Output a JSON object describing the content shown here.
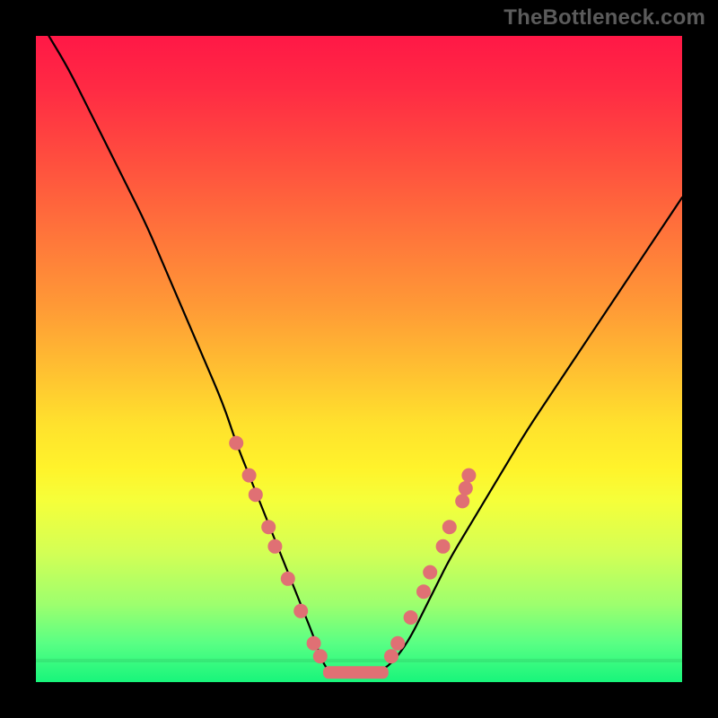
{
  "watermark": "TheBottleneck.com",
  "colors": {
    "curve_stroke": "#000000",
    "marker_fill": "#e07074",
    "plateau_fill": "#e07074",
    "frame_bg": "#000000"
  },
  "chart_data": {
    "type": "line",
    "title": "",
    "xlabel": "",
    "ylabel": "",
    "xlim": [
      0,
      100
    ],
    "ylim": [
      0,
      100
    ],
    "x": [
      2,
      5,
      8,
      11,
      14,
      17,
      20,
      23,
      26,
      29,
      31,
      33,
      35,
      37,
      39,
      41,
      43,
      44,
      45,
      46,
      48,
      50,
      52,
      54,
      56,
      58,
      60,
      62,
      64,
      67,
      70,
      73,
      76,
      80,
      84,
      88,
      92,
      96,
      100
    ],
    "values": [
      100,
      95,
      89,
      83,
      77,
      71,
      64,
      57,
      50,
      43,
      37,
      32,
      27,
      22,
      17,
      12,
      7,
      4,
      2,
      1.5,
      1.5,
      1.5,
      1.5,
      2,
      4,
      7,
      11,
      15,
      19,
      24,
      29,
      34,
      39,
      45,
      51,
      57,
      63,
      69,
      75
    ],
    "plateau": {
      "x_start": 45,
      "x_end": 54,
      "y": 1.5
    },
    "markers": [
      {
        "x": 31,
        "y": 37
      },
      {
        "x": 33,
        "y": 32
      },
      {
        "x": 34,
        "y": 29
      },
      {
        "x": 36,
        "y": 24
      },
      {
        "x": 37,
        "y": 21
      },
      {
        "x": 39,
        "y": 16
      },
      {
        "x": 41,
        "y": 11
      },
      {
        "x": 43,
        "y": 6
      },
      {
        "x": 44,
        "y": 4
      },
      {
        "x": 55,
        "y": 4
      },
      {
        "x": 56,
        "y": 6
      },
      {
        "x": 58,
        "y": 10
      },
      {
        "x": 60,
        "y": 14
      },
      {
        "x": 61,
        "y": 17
      },
      {
        "x": 63,
        "y": 21
      },
      {
        "x": 64,
        "y": 24
      },
      {
        "x": 66,
        "y": 28
      },
      {
        "x": 66.5,
        "y": 30
      },
      {
        "x": 67,
        "y": 32
      }
    ]
  }
}
